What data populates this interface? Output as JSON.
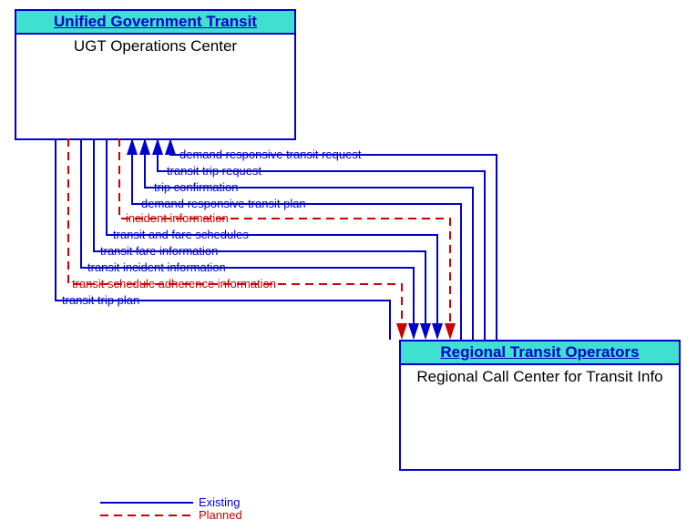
{
  "box1": {
    "header": "Unified Government Transit",
    "title": "UGT Operations Center"
  },
  "box2": {
    "header": "Regional Transit Operators",
    "title": "Regional Call Center for Transit Info"
  },
  "flows": {
    "f1": "demand responsive transit request",
    "f2": "transit trip request",
    "f3": "trip confirmation",
    "f4": "demand responsive transit plan",
    "f5": "incident information",
    "f6": "transit and fare schedules",
    "f7": "transit fare information",
    "f8": "transit incident information",
    "f9": "transit schedule adherence information",
    "f10": "transit trip plan"
  },
  "legend": {
    "existing": "Existing",
    "planned": "Planned"
  }
}
